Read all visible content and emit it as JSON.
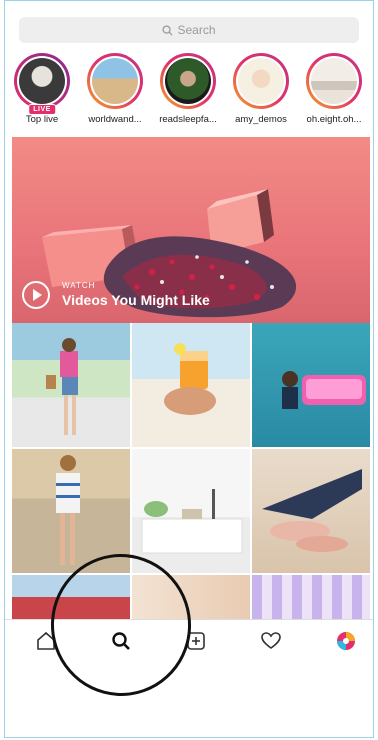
{
  "search": {
    "placeholder": "Search",
    "icon": "search-icon"
  },
  "stories": [
    {
      "label": "Top live",
      "live_badge": "LIVE"
    },
    {
      "label": "worldwand..."
    },
    {
      "label": "readsleepfa..."
    },
    {
      "label": "amy_demos"
    },
    {
      "label": "oh.eight.oh..."
    }
  ],
  "hero": {
    "watch_label": "WATCH",
    "title": "Videos You Might Like"
  },
  "tabbar": {
    "items": [
      "home-icon",
      "search-icon",
      "add-post-icon",
      "heart-icon",
      "profile-avatar-icon"
    ],
    "active": "search-icon"
  },
  "colors": {
    "story_ring": "#e1306c",
    "hero_bg": "#f28b86",
    "live": "#e1306c"
  }
}
